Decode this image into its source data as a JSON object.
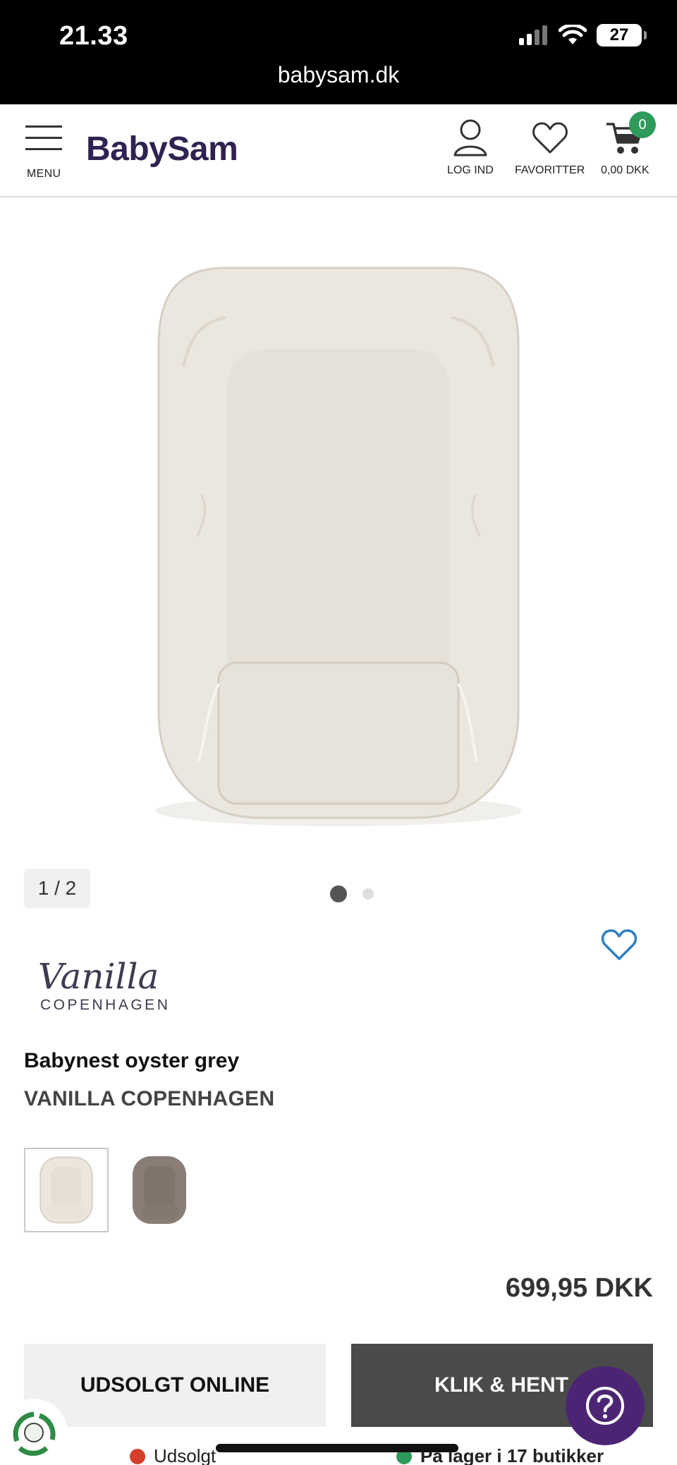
{
  "status_bar": {
    "time": "21.33",
    "battery": "27",
    "url": "babysam.dk"
  },
  "header": {
    "menu_label": "MENU",
    "logo": "BabySam",
    "login_label": "LOG IND",
    "favorites_label": "FAVORITTER",
    "cart_total": "0,00 DKK",
    "cart_count": "0"
  },
  "gallery": {
    "counter": "1 / 2",
    "total_images": 2,
    "active_index": 1
  },
  "brand_logo": {
    "name": "Vanilla",
    "sub": "COPENHAGEN"
  },
  "product": {
    "title": "Babynest oyster grey",
    "brand": "VANILLA COPENHAGEN",
    "price": "699,95 DKK",
    "swatches": [
      {
        "color": "#ece6dd",
        "selected": true
      },
      {
        "color": "#8a7d76",
        "selected": false
      }
    ]
  },
  "buttons": {
    "soldout_online": "UDSOLGT ONLINE",
    "click_collect": "KLIK & HENT"
  },
  "stock": {
    "online": {
      "label": "Udsolgt",
      "color": "#d4402c"
    },
    "stores": {
      "label": "På lager i 17 butikker",
      "color": "#2e9a5a"
    }
  },
  "colors": {
    "brand": "#2f2250",
    "help_button": "#4b2574",
    "favorite": "#2f7fc1"
  }
}
